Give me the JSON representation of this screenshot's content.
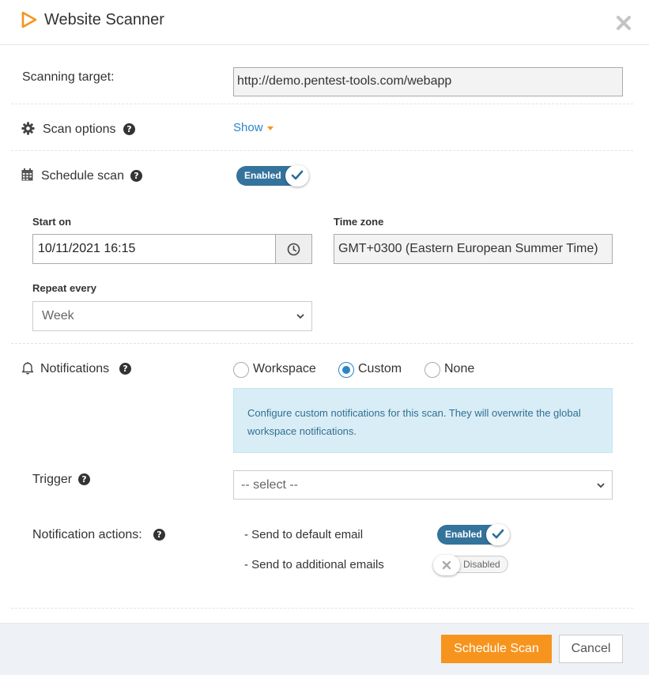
{
  "header": {
    "title": "Website Scanner",
    "logo_icon": "play-triangle-outline-icon",
    "close_icon": "close-icon"
  },
  "target": {
    "label": "Scanning target:",
    "value": "http://demo.pentest-tools.com/webapp"
  },
  "scan_options": {
    "label": "Scan options",
    "icon": "gear-icon",
    "show_label": "Show"
  },
  "schedule": {
    "label": "Schedule scan",
    "icon": "calendar-icon",
    "toggle_label": "Enabled",
    "start_on_label": "Start on",
    "start_on_value": "10/11/2021 16:15",
    "time_zone_label": "Time zone",
    "time_zone_value": "GMT+0300 (Eastern European Summer Time)",
    "repeat_label": "Repeat every",
    "repeat_value": "Week"
  },
  "notifications": {
    "label": "Notifications",
    "icon": "bell-icon",
    "options": [
      "Workspace",
      "Custom",
      "None"
    ],
    "selected": "Custom",
    "info_text": "Configure custom notifications for this scan. They will overwrite the global workspace notifications.",
    "trigger_label": "Trigger",
    "trigger_placeholder": "-- select --",
    "actions_label": "Notification actions:",
    "actions": [
      {
        "label": "- Send to default email",
        "state": "Enabled"
      },
      {
        "label": "- Send to additional emails",
        "state": "Disabled"
      }
    ]
  },
  "footer": {
    "primary_button": "Schedule Scan",
    "cancel_button": "Cancel"
  },
  "colors": {
    "accent": "#f7941d",
    "toggle_on": "#34739c",
    "link": "#2a86c8",
    "info_bg": "#d9edf7"
  }
}
